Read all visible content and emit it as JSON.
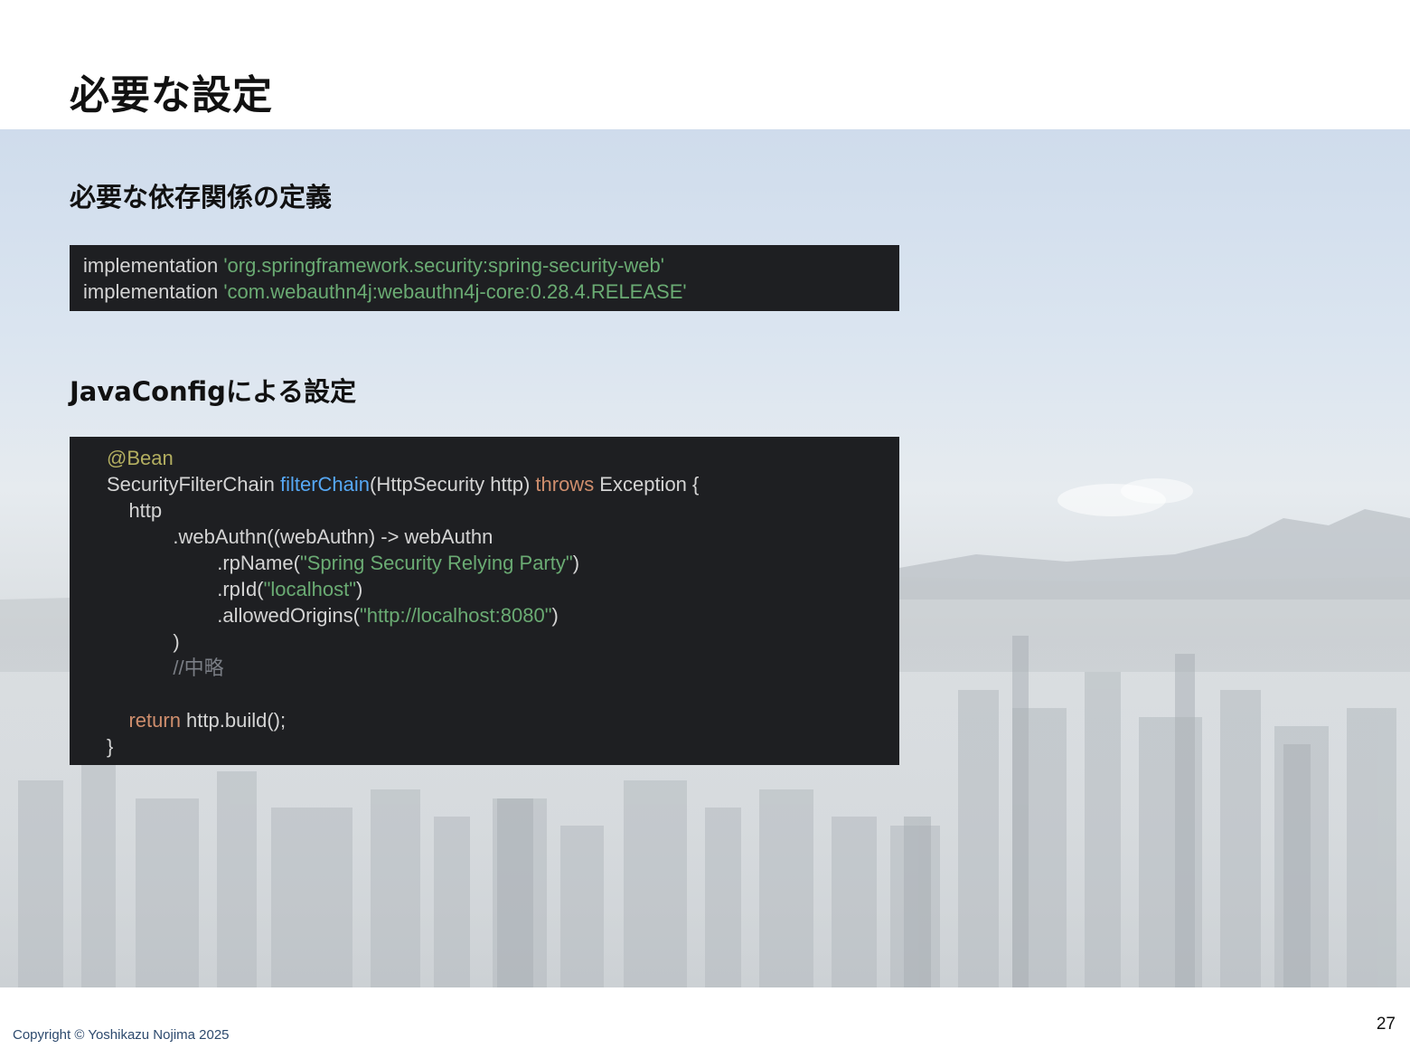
{
  "slide": {
    "title": "必要な設定",
    "page_number": "27",
    "copyright": "Copyright © Yoshikazu Nojima 2025"
  },
  "section1": {
    "heading": "必要な依存関係の定義",
    "lines": [
      [
        {
          "text": "implementation ",
          "kind": "pl"
        },
        {
          "text": "'org.springframework.security:spring-security-web'",
          "kind": "str"
        }
      ],
      [
        {
          "text": "implementation ",
          "kind": "pl"
        },
        {
          "text": "'com.webauthn4j:webauthn4j-core:0.28.4.RELEASE'",
          "kind": "str"
        }
      ]
    ]
  },
  "section2": {
    "heading": "JavaConfigによる設定",
    "lines": [
      [
        {
          "text": "@Bean",
          "kind": "ann"
        }
      ],
      [
        {
          "text": "SecurityFilterChain ",
          "kind": "pl"
        },
        {
          "text": "filterChain",
          "kind": "fn"
        },
        {
          "text": "(HttpSecurity http) ",
          "kind": "pl"
        },
        {
          "text": "throws",
          "kind": "kw"
        },
        {
          "text": " Exception {",
          "kind": "pl"
        }
      ],
      [
        {
          "text": "    http",
          "kind": "pl"
        }
      ],
      [
        {
          "text": "            .webAuthn((webAuthn) -> webAuthn",
          "kind": "pl"
        }
      ],
      [
        {
          "text": "                    .rpName(",
          "kind": "pl"
        },
        {
          "text": "\"Spring Security Relying Party\"",
          "kind": "str"
        },
        {
          "text": ")",
          "kind": "pl"
        }
      ],
      [
        {
          "text": "                    .rpId(",
          "kind": "pl"
        },
        {
          "text": "\"localhost\"",
          "kind": "str"
        },
        {
          "text": ")",
          "kind": "pl"
        }
      ],
      [
        {
          "text": "                    .allowedOrigins(",
          "kind": "pl"
        },
        {
          "text": "\"http://localhost:8080\"",
          "kind": "str"
        },
        {
          "text": ")",
          "kind": "pl"
        }
      ],
      [
        {
          "text": "            )",
          "kind": "pl"
        }
      ],
      [
        {
          "text": "            //中略",
          "kind": "cm"
        }
      ],
      [
        {
          "text": "",
          "kind": "pl"
        }
      ],
      [
        {
          "text": "    ",
          "kind": "pl"
        },
        {
          "text": "return",
          "kind": "kw"
        },
        {
          "text": " http.build();",
          "kind": "pl"
        }
      ],
      [
        {
          "text": "}",
          "kind": "pl"
        }
      ]
    ]
  },
  "colors": {
    "code_background": "#1e1f22",
    "string": "#6aab73",
    "annotation": "#b3ae60",
    "function": "#56a8f5",
    "keyword": "#cf8e6d",
    "comment": "#7a7e85",
    "plain": "#d4d4d4"
  }
}
